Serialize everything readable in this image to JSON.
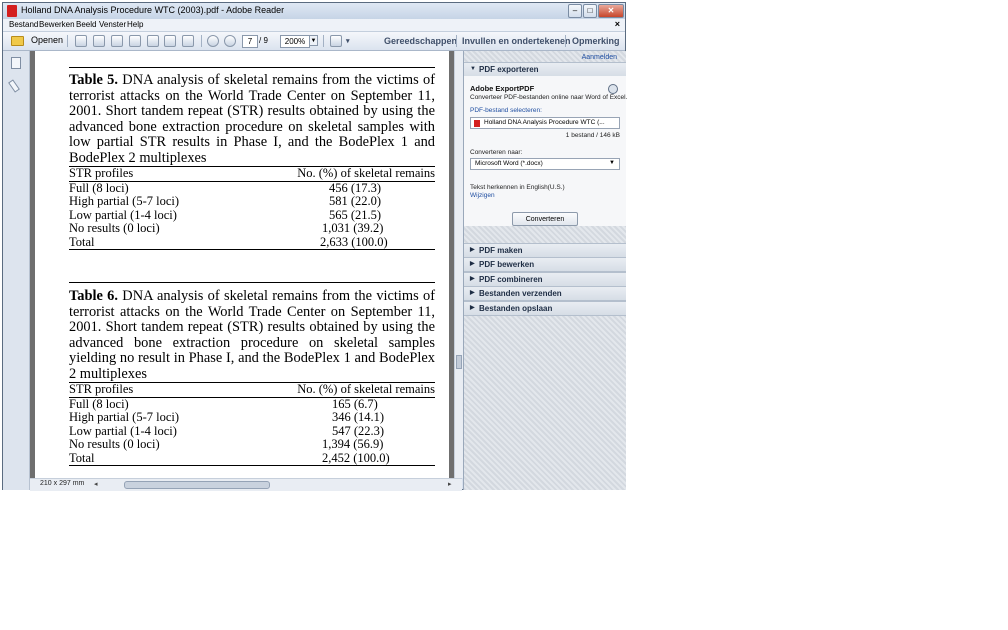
{
  "window": {
    "title": "Holland DNA Analysis Procedure WTC (2003).pdf - Adobe Reader",
    "menu": [
      "Bestand",
      "Bewerken",
      "Beeld",
      "Venster",
      "Help"
    ]
  },
  "toolbar": {
    "open_label": "Openen",
    "page_current": "7",
    "page_total": "/ 9",
    "zoom": "200%",
    "links": [
      "Gereedschappen",
      "Invullen en ondertekenen",
      "Opmerking"
    ]
  },
  "status": {
    "page_size": "210 x 297 mm"
  },
  "document": {
    "table5": {
      "label": "Table 5.",
      "caption": " DNA analysis of skeletal remains from the victims of terrorist attacks on the World Trade Center on September 11, 2001. Short tandem repeat (STR) results obtained by using the advanced bone extraction procedure on skeletal samples with low partial STR results in Phase I, and the BodePlex 1 and BodePlex 2 multiplexes",
      "headers": [
        "STR profiles",
        "No. (%) of skeletal remains"
      ],
      "rows": [
        [
          "Full (8 loci)",
          "456 (17.3)"
        ],
        [
          "High partial (5-7 loci)",
          "581 (22.0)"
        ],
        [
          "Low partial (1-4 loci)",
          "565 (21.5)"
        ],
        [
          "No results (0 loci)",
          "1,031 (39.2)"
        ],
        [
          "Total",
          "2,633 (100.0)"
        ]
      ]
    },
    "table6": {
      "label": "Table 6.",
      "caption": " DNA analysis of skeletal remains from the victims of terrorist attacks on the World Trade Center on September 11, 2001. Short tandem repeat (STR) results obtained by using the advanced bone extraction procedure on skeletal samples yielding no result in Phase I, and the BodePlex 1 and BodePlex 2 multiplexes",
      "headers": [
        "STR profiles",
        "No. (%) of skeletal remains"
      ],
      "rows": [
        [
          "Full (8 loci)",
          "165 (6.7)"
        ],
        [
          "High partial (5-7 loci)",
          "346 (14.1)"
        ],
        [
          "Low partial (1-4 loci)",
          "547 (22.3)"
        ],
        [
          "No results (0 loci)",
          "1,394 (56.9)"
        ],
        [
          "Total",
          "2,452 (100.0)"
        ]
      ]
    }
  },
  "panel": {
    "signin": "Aanmelden",
    "export_header": "PDF exporteren",
    "export_title": "Adobe ExportPDF",
    "export_desc": "Converteer PDF-bestanden online naar Word of Excel.",
    "select_label": "PDF-bestand selecteren:",
    "file_name": "Holland DNA Analysis Procedure WTC (...",
    "file_size": "1 bestand / 146 kB",
    "convert_to_label": "Converteren naar:",
    "convert_to_value": "Microsoft Word (*.docx)",
    "lang_text": "Tekst herkennen in English(U.S.)",
    "lang_link": "Wijzigen",
    "convert_button": "Converteren",
    "sections": [
      "PDF maken",
      "PDF bewerken",
      "PDF combineren",
      "Bestanden verzenden",
      "Bestanden opslaan"
    ]
  }
}
